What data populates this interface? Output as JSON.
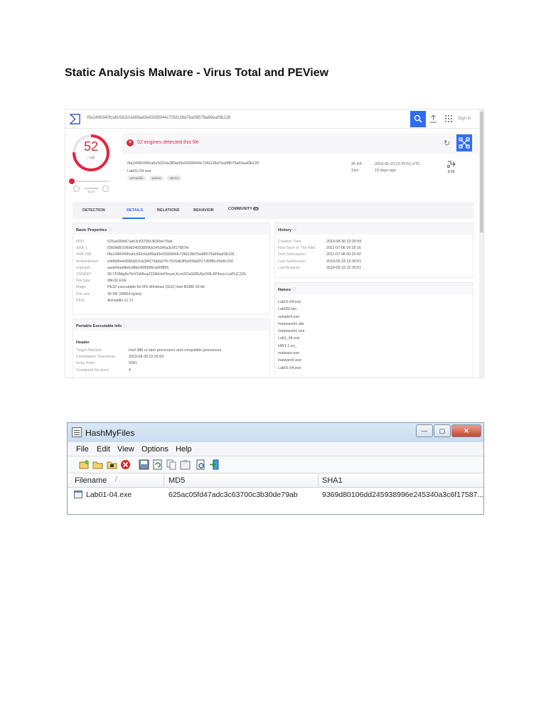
{
  "document": {
    "title": "Static Analysis Malware - Virus Total and PEView"
  },
  "virustotal": {
    "search_hash": "0fa1498340fca6c562cfa389ad3e93395f44c72fd128d7ba08579a69aaf3b126",
    "signin": "Sign in",
    "score": {
      "detected": "52",
      "total": "/ 69",
      "detected_value": 52,
      "total_value": 69
    },
    "community_label": "Community Score",
    "banner": "52 engines detected this file",
    "file_hash": "0fa1498340fca6c562cfa389ad3e93395f44c72fd128d7ba08579a69aaf3b126",
    "file_name": "Lab01-04.exe",
    "tags": [
      "armadillo",
      "peexe",
      "via-tor"
    ],
    "size_value": "36 KB",
    "size_label": "Size",
    "date_value": "2019-05-23 22:30:51 UTC",
    "date_ago": "19 days ago",
    "file_type": "EXE",
    "tabs": [
      "DETECTION",
      "DETAILS",
      "RELATIONS",
      "BEHAVIOR",
      "COMMUNITY"
    ],
    "community_badge": "16",
    "basic_properties": {
      "title": "Basic Properties",
      "rows": [
        {
          "k": "MD5",
          "v": "625ac05fd47adc3c63700c3b30de79ab"
        },
        {
          "k": "SHA-1",
          "v": "9369d80106dd245938996e245340a3c6f17587fe"
        },
        {
          "k": "SHA-256",
          "v": "0fa1498340fca6c562cfa389ad3e93395f44c72fd128d7ba08579a69aaf3b126"
        },
        {
          "k": "Authentihash",
          "v": "edd9d6ea0080a921dc84273dda27fc7616db3f9af00dd2f17d58f6c09e8c150"
        },
        {
          "k": "Imphash",
          "v": "aade0eabfbdcd8be36f6996ca66f805"
        },
        {
          "k": "SSDEEP",
          "v": "96:TF0MgAv7triYSAAvqZ22NrHsP4oynLKcmSOzG08U6p2WL4P4oyn:LiaPLjC2Zh"
        },
        {
          "k": "File type",
          "v": "Win32 EXE"
        },
        {
          "k": "Magic",
          "v": "PE32 executable for MS Windows (GUI) Intel 80386 32-bit"
        },
        {
          "k": "File size",
          "v": "36 KB (36864 bytes)"
        },
        {
          "k": "PEiD",
          "v": "Armadillo v1.71"
        }
      ]
    },
    "pe_info": {
      "title": "Portable Executable Info",
      "subtitle": "Header",
      "rows": [
        {
          "k": "Target Machine",
          "v": "Intel 386 or later processors and compatible processors"
        },
        {
          "k": "Compilation Timestamp",
          "v": "2019-08-30 22:26:59"
        },
        {
          "k": "Entry Point",
          "v": "5581"
        },
        {
          "k": "Contained Sections",
          "v": "4"
        }
      ]
    },
    "history": {
      "title": "History",
      "rows": [
        {
          "k": "Creation Time",
          "v": "2019-08-30 22:26:59"
        },
        {
          "k": "First Seen In The Wild",
          "v": "2011-07-06 16:16:16"
        },
        {
          "k": "First Submission",
          "v": "2011-07-06 00:35:42"
        },
        {
          "k": "Last Submission",
          "v": "2019-05-23 22:30:51"
        },
        {
          "k": "Last Analysis",
          "v": "2019-05-23 22:30:51"
        }
      ]
    },
    "names": {
      "title": "Names",
      "items": [
        "Lab01-04.exe",
        "Lab002.bin",
        "sample4.exe",
        "homework1.dat",
        "homework1.exe",
        "Lab1_04.exe",
        "HW1-1.ex_",
        "malware.exe",
        "malware5.exe",
        "Lab01-04.exe"
      ]
    }
  },
  "hashmyfiles": {
    "title": "HashMyFiles",
    "menu": [
      "File",
      "Edit",
      "View",
      "Options",
      "Help"
    ],
    "columns": [
      "Filename",
      "MD5",
      "SHA1"
    ],
    "row": {
      "filename": "Lab01-04.exe",
      "md5": "625ac05fd47adc3c63700c3b30de79ab",
      "sha1": "9369d80106dd245938996e245340a3c6f17587..."
    }
  }
}
